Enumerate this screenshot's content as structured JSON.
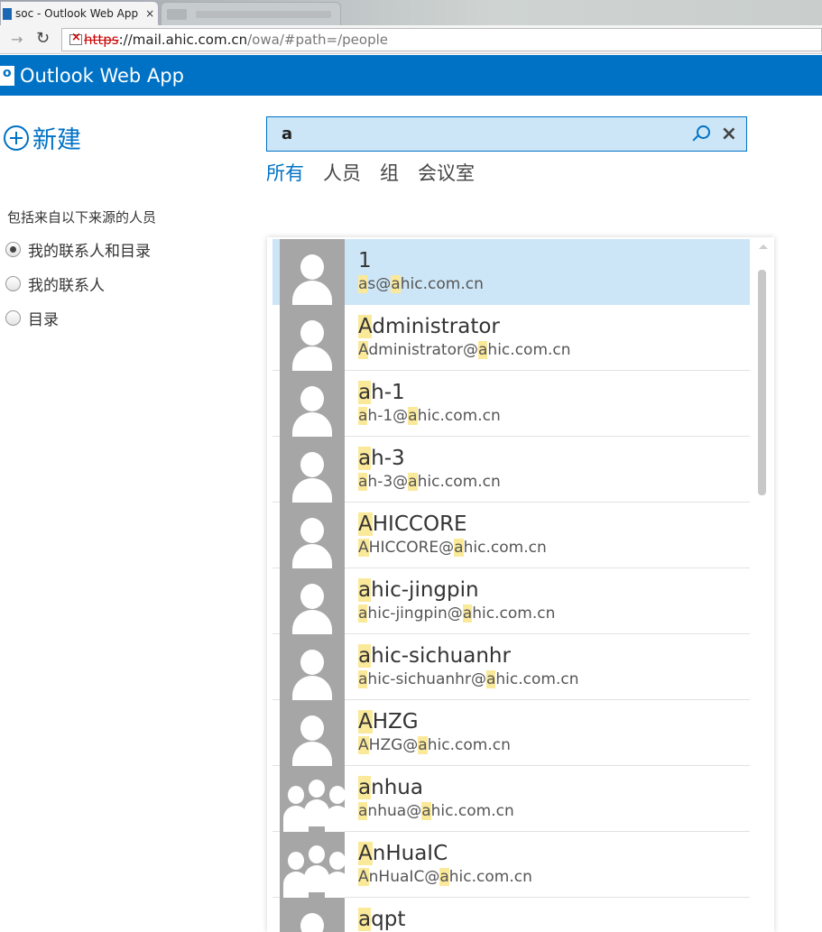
{
  "browser": {
    "active_tab_title": "soc - Outlook Web App",
    "tab_close": "×",
    "url_scheme": "https",
    "url_host": "://mail.ahic.com.cn",
    "url_path": "/owa/#path=/people"
  },
  "app": {
    "title": "Outlook Web App"
  },
  "new_button": {
    "label": "新建"
  },
  "search": {
    "query": "a",
    "clear": "×"
  },
  "filter_tabs": [
    "所有",
    "人员",
    "组",
    "会议室"
  ],
  "sources": {
    "heading": "包括来自以下来源的人员",
    "options": [
      "我的联系人和目录",
      "我的联系人",
      "目录"
    ],
    "selected_index": 0
  },
  "results": [
    {
      "name": "1",
      "email": "as@ahic.com.cn",
      "type": "person"
    },
    {
      "name": "Administrator",
      "email": "Administrator@ahic.com.cn",
      "type": "person"
    },
    {
      "name": "ah-1",
      "email": "ah-1@ahic.com.cn",
      "type": "person"
    },
    {
      "name": "ah-3",
      "email": "ah-3@ahic.com.cn",
      "type": "person"
    },
    {
      "name": "AHICCORE",
      "email": "AHICCORE@ahic.com.cn",
      "type": "person"
    },
    {
      "name": "ahic-jingpin",
      "email": "ahic-jingpin@ahic.com.cn",
      "type": "person"
    },
    {
      "name": "ahic-sichuanhr",
      "email": "ahic-sichuanhr@ahic.com.cn",
      "type": "person"
    },
    {
      "name": "AHZG",
      "email": "AHZG@ahic.com.cn",
      "type": "person"
    },
    {
      "name": "anhua",
      "email": "anhua@ahic.com.cn",
      "type": "group"
    },
    {
      "name": "AnHuaIC",
      "email": "AnHuaIC@ahic.com.cn",
      "type": "group"
    },
    {
      "name": "aqpt",
      "email": "",
      "type": "person"
    }
  ],
  "colors": {
    "brand": "#0072c6",
    "selected_row": "#cde6f7",
    "highlight": "#fbe99a"
  }
}
